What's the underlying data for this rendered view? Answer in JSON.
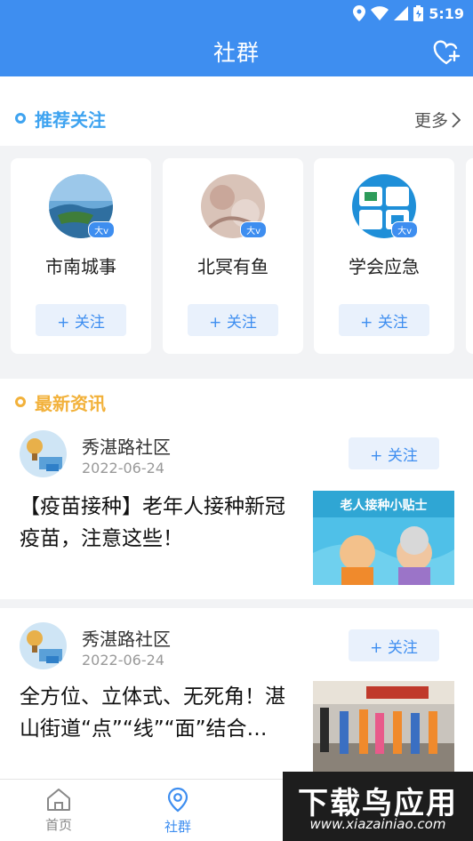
{
  "status_bar": {
    "time": "5:19"
  },
  "header": {
    "title": "社群"
  },
  "recommend": {
    "title": "推荐关注",
    "more_label": "更多",
    "cards": [
      {
        "name": "市南城事",
        "badge": "大v",
        "follow_label": "+ 关注"
      },
      {
        "name": "北冥有鱼",
        "badge": "大v",
        "follow_label": "+ 关注"
      },
      {
        "name": "学会应急",
        "badge": "大v",
        "follow_label": "+ 关注"
      }
    ]
  },
  "news": {
    "title": "最新资讯",
    "items": [
      {
        "source": "秀湛路社区",
        "date": "2022-06-24",
        "follow_label": "+ 关注",
        "title": "【疫苗接种】老年人接种新冠疫苗，注意这些！",
        "thumb_caption": "老人接种小贴士"
      },
      {
        "source": "秀湛路社区",
        "date": "2022-06-24",
        "follow_label": "+ 关注",
        "title": "全方位、立体式、无死角！湛山街道“点”“线”“面”结合…"
      }
    ]
  },
  "tabs": [
    {
      "label": "首页",
      "icon": "home-icon",
      "active": false
    },
    {
      "label": "社群",
      "icon": "location-pin-icon",
      "active": true
    }
  ],
  "watermark": {
    "text": "下载鸟应用",
    "url": "www.xiazainiao.com"
  },
  "colors": {
    "primary": "#3e8ef0",
    "accent_orange": "#f2b13a",
    "accent_blue": "#3ea3f0"
  }
}
